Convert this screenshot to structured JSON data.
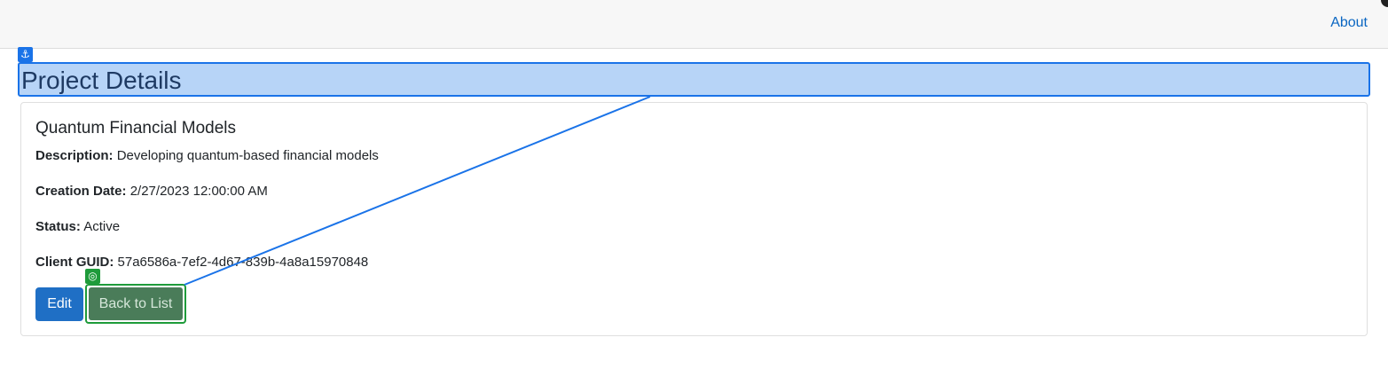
{
  "nav": {
    "about_label": "About"
  },
  "page": {
    "title": "Project Details"
  },
  "project": {
    "name": "Quantum Financial Models",
    "fields": [
      {
        "label": "Description:",
        "value": "Developing quantum-based financial models"
      },
      {
        "label": "Creation Date:",
        "value": "2/27/2023 12:00:00 AM"
      },
      {
        "label": "Status:",
        "value": "Active"
      },
      {
        "label": "Client GUID:",
        "value": "57a6586a-7ef2-4d67-839b-4a8a15970848"
      }
    ]
  },
  "actions": {
    "edit_label": "Edit",
    "back_label": "Back to List"
  },
  "overlay": {
    "anchor_icon": "anchor-icon",
    "target_icon": "target-icon",
    "anchor_color": "#1a73e8",
    "target_color": "#1e9b3a"
  }
}
